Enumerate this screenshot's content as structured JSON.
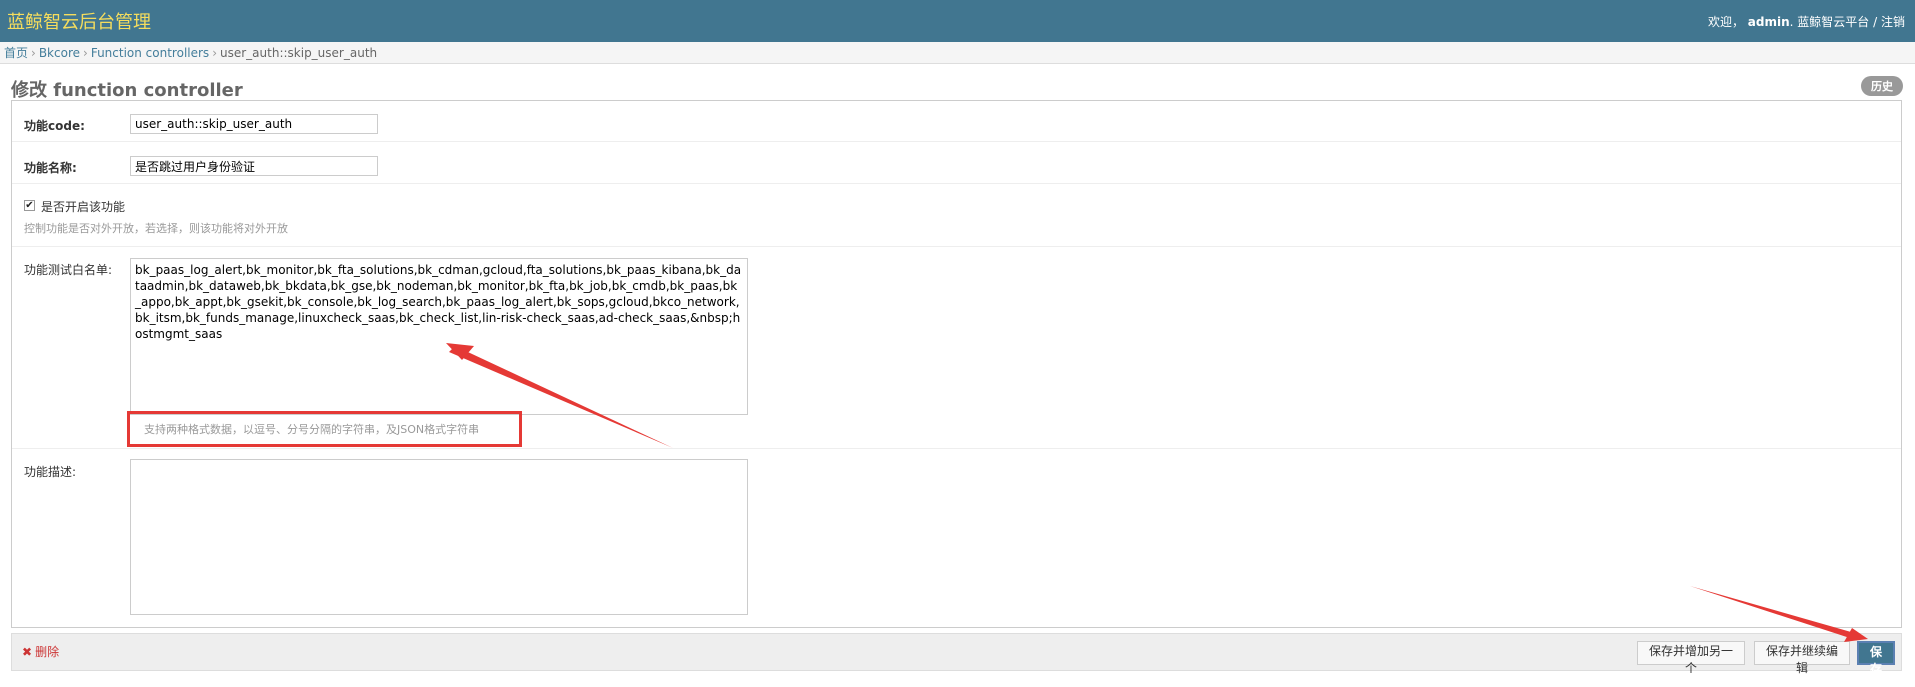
{
  "header": {
    "site_title": "蓝鲸智云后台管理",
    "welcome": "欢迎，",
    "username": "admin",
    "separator": ".",
    "platform_link": "蓝鲸智云平台",
    "slash": " / ",
    "logout_link": "注销"
  },
  "breadcrumb": {
    "home": "首页",
    "app": "Bkcore",
    "model": "Function controllers",
    "current": "user_auth::skip_user_auth",
    "separator": "›"
  },
  "page": {
    "title": "修改 function controller",
    "history_button": "历史"
  },
  "form": {
    "func_code": {
      "label": "功能code:",
      "value": "user_auth::skip_user_auth"
    },
    "func_name": {
      "label": "功能名称:",
      "value": "是否跳过用户身份验证"
    },
    "enabled": {
      "checked": true,
      "label": "是否开启该功能",
      "help": "控制功能是否对外开放，若选择，则该功能将对外开放"
    },
    "whitelist": {
      "label": "功能测试白名单:",
      "value": "bk_paas_log_alert,bk_monitor,bk_fta_solutions,bk_cdman,gcloud,fta_solutions,bk_paas_kibana,bk_dataadmin,bk_dataweb,bk_bkdata,bk_gse,bk_nodeman,bk_monitor,bk_fta,bk_job,bk_cmdb,bk_paas,bk_appo,bk_appt,bk_gsekit,bk_console,bk_log_search,bk_paas_log_alert,bk_sops,gcloud,bkco_network,bk_itsm,bk_funds_manage,linuxcheck_saas,bk_check_list,lin-risk-check_saas,ad-check_saas,&nbsp;hostmgmt_saas",
      "help": "支持两种格式数据，以逗号、分号分隔的字符串，及JSON格式字符串"
    },
    "description": {
      "label": "功能描述:",
      "value": ""
    }
  },
  "submit_row": {
    "delete": "删除",
    "delete_icon": "✖",
    "save_add_another": "保存并增加另一个",
    "save_continue": "保存并继续编辑",
    "save": "保存"
  },
  "colors": {
    "header_bg": "#417690",
    "title_yellow": "#f5dd5d",
    "annotation_red": "#e53935"
  }
}
